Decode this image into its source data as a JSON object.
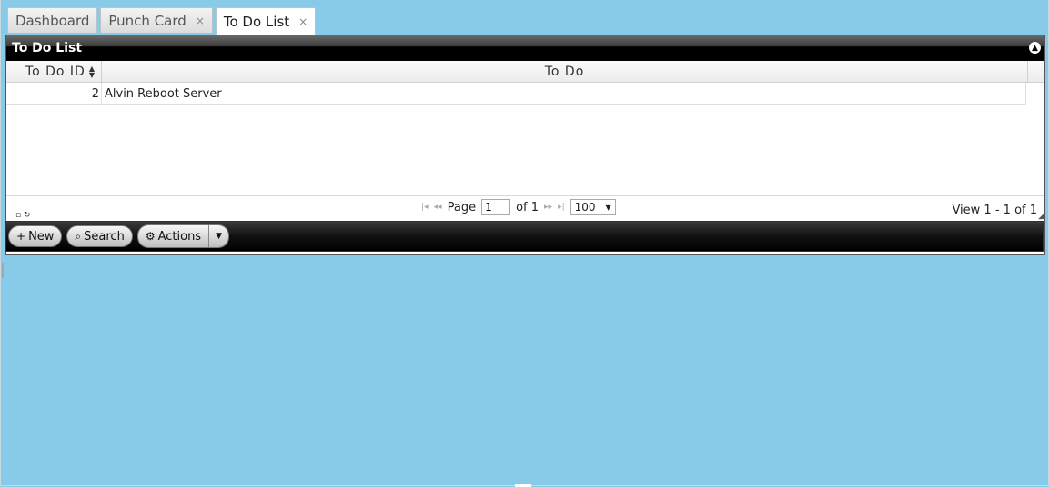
{
  "tabs": [
    {
      "label": "Dashboard",
      "closable": false
    },
    {
      "label": "Punch Card",
      "closable": true
    },
    {
      "label": "To Do List",
      "closable": true,
      "active": true
    }
  ],
  "tab_close_glyph": "×",
  "panel": {
    "title": "To Do List",
    "collapse_glyph": "▲"
  },
  "grid": {
    "columns": [
      "To Do ID",
      "To Do"
    ],
    "rows": [
      {
        "id": "2",
        "todo": "Alvin Reboot Server"
      }
    ]
  },
  "pager": {
    "page_label": "Page",
    "page_value": "1",
    "of_label": "of 1",
    "rows_per_page": "100",
    "view_info": "View 1 - 1 of 1",
    "first_glyph": "|◂",
    "prev_glyph": "◂◂",
    "next_glyph": "▸▸",
    "last_glyph": "▸|"
  },
  "toolbar": {
    "new_label": "New",
    "search_label": "Search",
    "actions_label": "Actions",
    "new_icon": "plus-icon",
    "search_icon": "magnifier-icon",
    "actions_icon": "gear-icon"
  },
  "colors": {
    "background": "#87CBE8",
    "panel_title_bg": "#000000"
  }
}
